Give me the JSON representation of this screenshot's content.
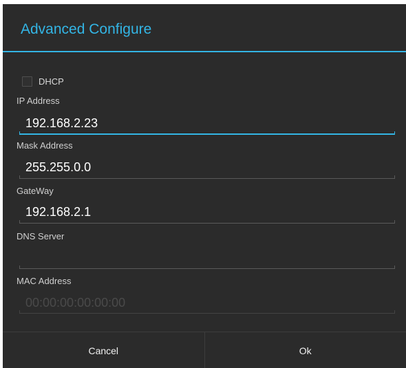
{
  "dialog": {
    "title": "Advanced Configure",
    "accent_color": "#33b5e5",
    "background_color": "#2b2b2b"
  },
  "dhcp": {
    "label": "DHCP",
    "checked": false
  },
  "fields": {
    "ip": {
      "label": "IP Address",
      "value": "192.168.2.23",
      "focused": true
    },
    "mask": {
      "label": "Mask Address",
      "value": "255.255.0.0"
    },
    "gateway": {
      "label": "GateWay",
      "value": "192.168.2.1"
    },
    "dns": {
      "label": "DNS Server",
      "value": ""
    },
    "mac": {
      "label": "MAC Address",
      "placeholder": "00:00:00:00:00:00",
      "enabled": false
    }
  },
  "buttons": {
    "cancel": "Cancel",
    "ok": "Ok"
  }
}
